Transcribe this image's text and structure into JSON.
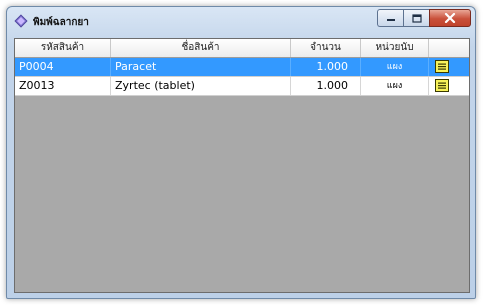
{
  "window": {
    "title": "พิมพ์ฉลากยา",
    "accent": "#3399ff",
    "close_color": "#c9503a"
  },
  "table": {
    "headers": {
      "code": "รหัสสินค้า",
      "name": "ชื่อสินค้า",
      "qty": "จำนวน",
      "unit": "หน่วยนับ",
      "action": ""
    },
    "rows": [
      {
        "code": "P0004",
        "name": "Paracet",
        "qty": "1.000",
        "unit": "แผง",
        "icon": "note-icon",
        "selected": true
      },
      {
        "code": "Z0013",
        "name": "Zyrtec (tablet)",
        "qty": "1.000",
        "unit": "แผง",
        "icon": "note-icon",
        "selected": false
      }
    ]
  }
}
